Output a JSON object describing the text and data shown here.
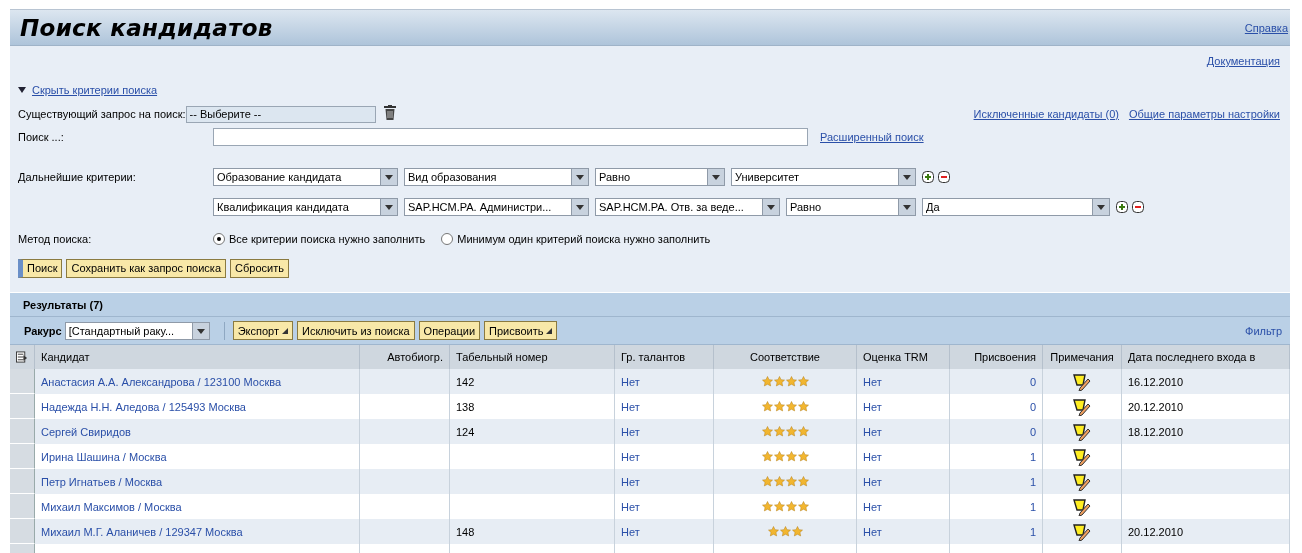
{
  "title": "Поиск кандидатов",
  "help_link": "Справка",
  "documentation_link": "Документация",
  "toggle_criteria": {
    "label": "Скрыть критерии поиска",
    "expanded": true
  },
  "existing_query": {
    "label": "Существующий запрос на поиск:",
    "value": "-- Выберите --"
  },
  "links_right": [
    "Исключенные кандидаты (0)",
    "Общие параметры настройки"
  ],
  "search": {
    "label": "Поиск ...:",
    "advanced_link": "Расширенный поиск"
  },
  "further_criteria": {
    "label": "Дальнейшие критерии:",
    "rows": [
      {
        "fields": [
          "Образование кандидата",
          "Вид образования",
          "Равно",
          "Университет"
        ]
      },
      {
        "fields": [
          "Квалификация кандидата",
          "SAP.HCM.PA. Администри...",
          "SAP.HCM.PA. Отв. за веде...",
          "Равно",
          "Да"
        ]
      }
    ]
  },
  "search_method": {
    "label": "Метод поиска:",
    "options": [
      {
        "label": "Все критерии поиска нужно заполнить",
        "selected": true
      },
      {
        "label": "Минимум один критерий поиска нужно заполнить",
        "selected": false
      }
    ]
  },
  "buttons": [
    {
      "label": "Поиск",
      "primary": true
    },
    {
      "label": "Сохранить как запрос поиска",
      "primary": false
    },
    {
      "label": "Сбросить",
      "primary": false
    }
  ],
  "results": {
    "title": "Результаты (7)",
    "view": {
      "label": "Ракурс",
      "value": "[Стандартный раку..."
    },
    "toolbar": [
      {
        "label": "Экспорт",
        "menu": true
      },
      {
        "label": "Исключить из поиска",
        "menu": false
      },
      {
        "label": "Операции",
        "menu": false
      },
      {
        "label": "Присвоить",
        "menu": true
      }
    ],
    "filter_link": "Фильтр",
    "columns": [
      "Кандидат",
      "Автобиогр.",
      "Табельный номер",
      "Гр. талантов",
      "Соответствие",
      "Оценка TRM",
      "Присвоения",
      "Примечания",
      "Дата последнего входа в"
    ],
    "rows": [
      {
        "candidate": "Анастасия А.А. Александрова / 123100 Москва",
        "personnel_number": "142",
        "talent_group": "Нет",
        "stars": 4,
        "trm": "Нет",
        "assignments": "0",
        "last_login": "16.12.2010"
      },
      {
        "candidate": "Надежда Н.Н. Аледова / 125493 Москва",
        "personnel_number": "138",
        "talent_group": "Нет",
        "stars": 4,
        "trm": "Нет",
        "assignments": "0",
        "last_login": "20.12.2010"
      },
      {
        "candidate": "Сергей Свиридов",
        "personnel_number": "124",
        "talent_group": "Нет",
        "stars": 4,
        "trm": "Нет",
        "assignments": "0",
        "last_login": "18.12.2010"
      },
      {
        "candidate": "Ирина Шашина / Москва",
        "talent_group": "Нет",
        "stars": 4,
        "trm": "Нет",
        "assignments": "1"
      },
      {
        "candidate": "Петр Игнатьев / Москва",
        "talent_group": "Нет",
        "stars": 4,
        "trm": "Нет",
        "assignments": "1"
      },
      {
        "candidate": "Михаил Максимов / Москва",
        "talent_group": "Нет",
        "stars": 4,
        "trm": "Нет",
        "assignments": "1"
      },
      {
        "candidate": "Михаил М.Г. Аланичев / 129347 Москва",
        "personnel_number": "148",
        "talent_group": "Нет",
        "stars": 3,
        "trm": "Нет",
        "assignments": "1",
        "last_login": "20.12.2010"
      }
    ]
  }
}
